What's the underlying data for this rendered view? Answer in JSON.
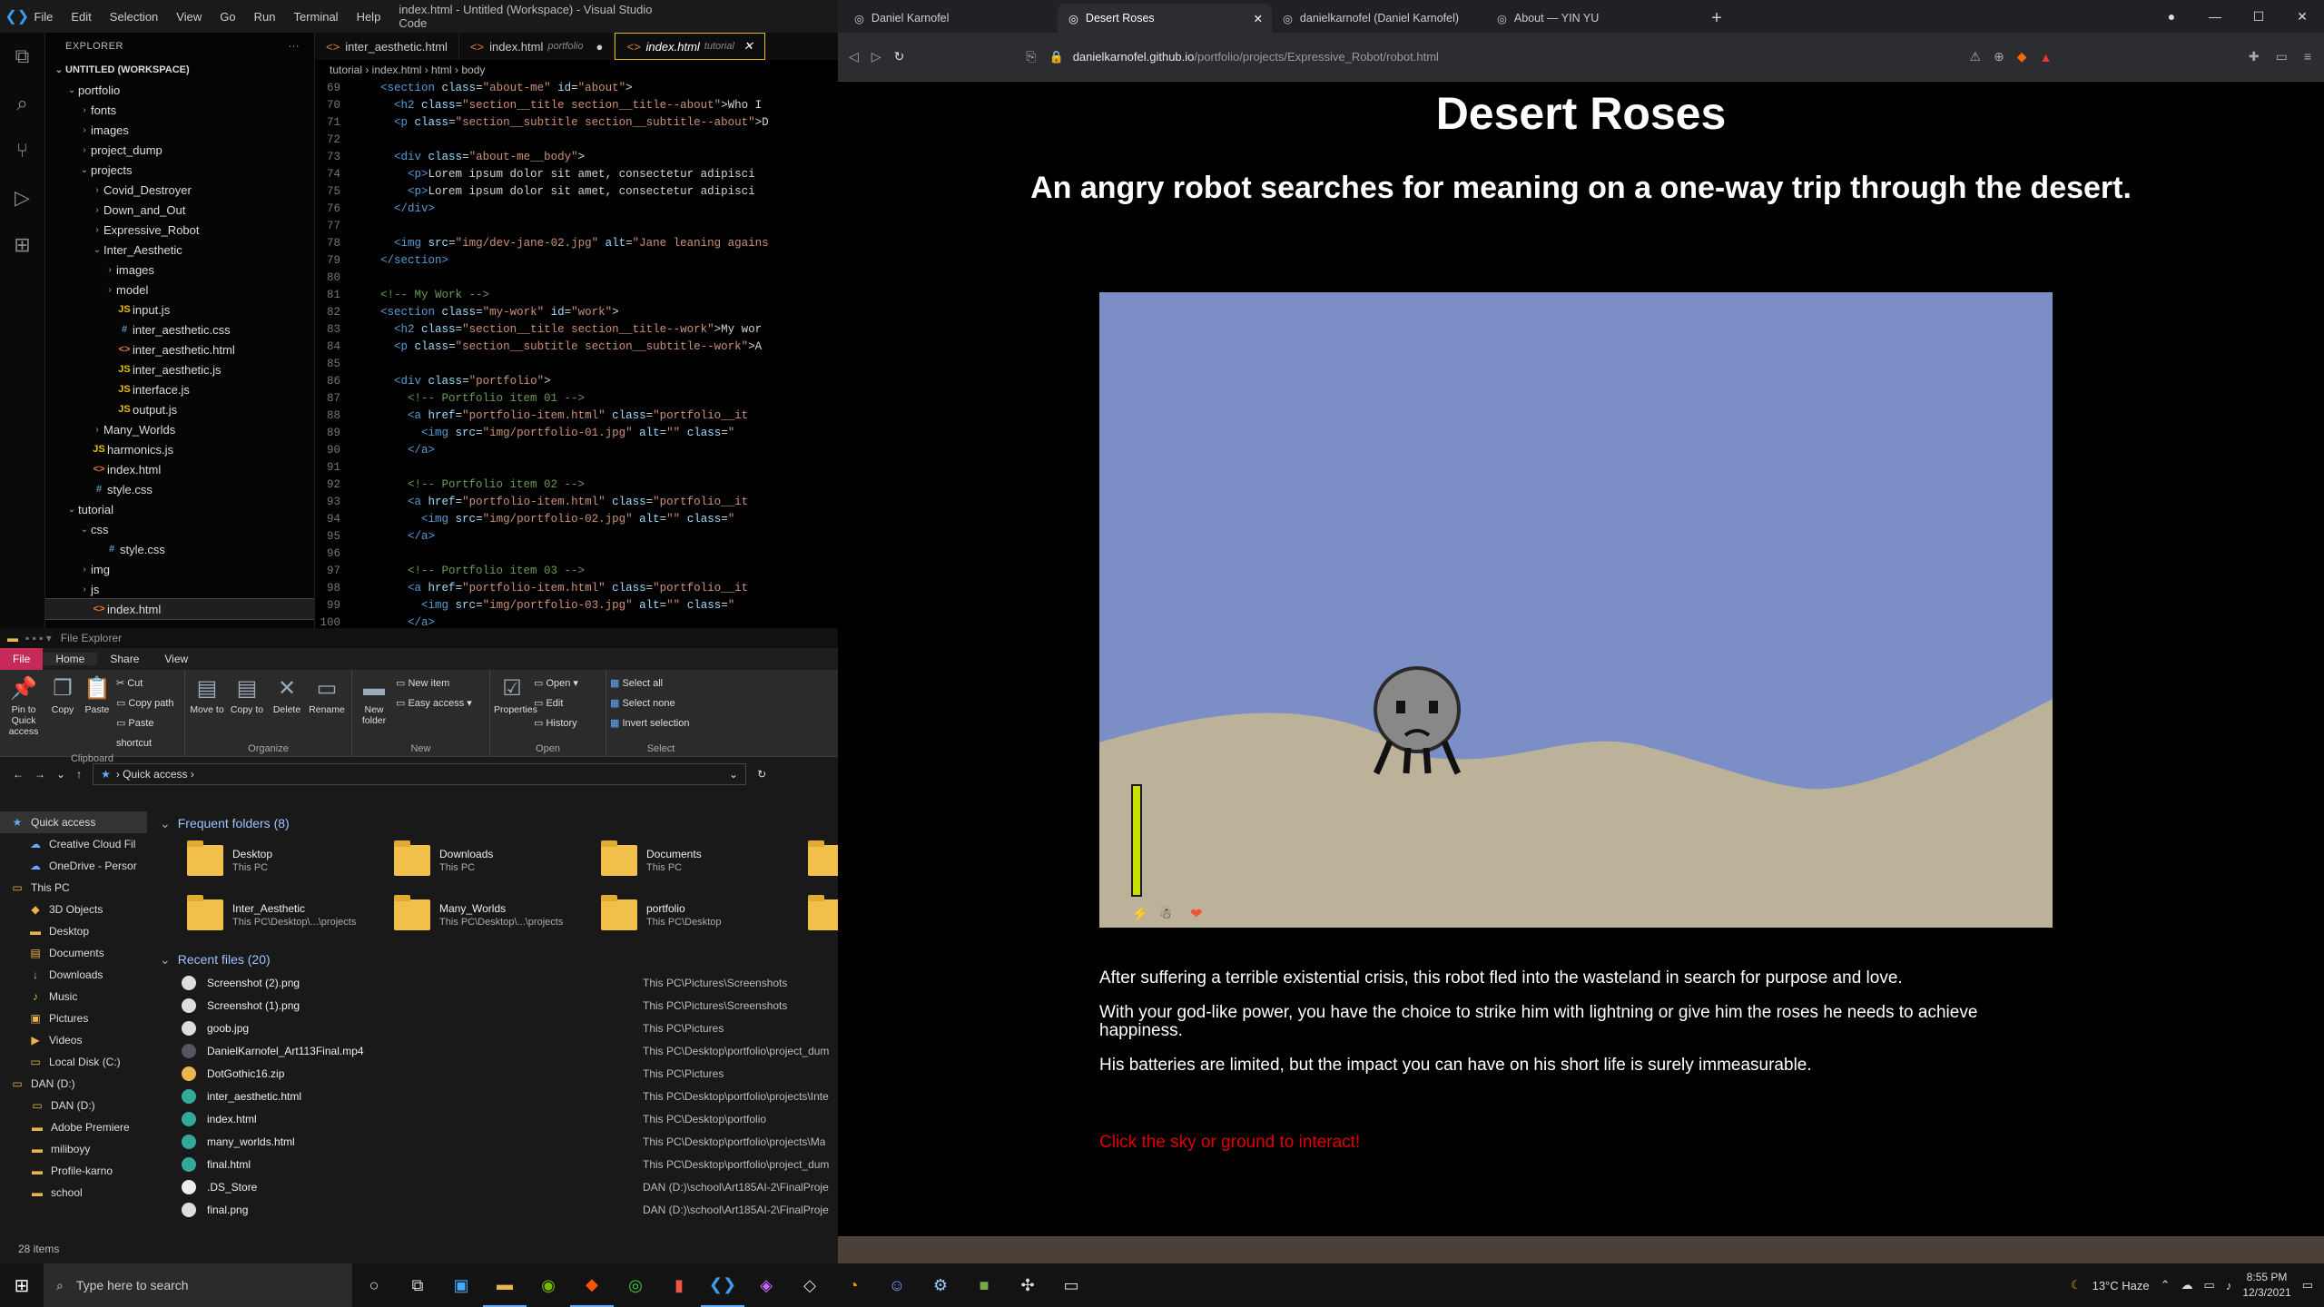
{
  "vscode": {
    "menu": [
      "File",
      "Edit",
      "Selection",
      "View",
      "Go",
      "Run",
      "Terminal",
      "Help"
    ],
    "title": "index.html - Untitled (Workspace) - Visual Studio Code",
    "explorer_label": "EXPLORER",
    "workspace": "UNTITLED (WORKSPACE)",
    "tree": [
      {
        "label": "portfolio",
        "d": 1,
        "t": "open"
      },
      {
        "label": "fonts",
        "d": 2,
        "t": "closed"
      },
      {
        "label": "images",
        "d": 2,
        "t": "closed"
      },
      {
        "label": "project_dump",
        "d": 2,
        "t": "closed"
      },
      {
        "label": "projects",
        "d": 2,
        "t": "open"
      },
      {
        "label": "Covid_Destroyer",
        "d": 3,
        "t": "closed"
      },
      {
        "label": "Down_and_Out",
        "d": 3,
        "t": "closed"
      },
      {
        "label": "Expressive_Robot",
        "d": 3,
        "t": "closed"
      },
      {
        "label": "Inter_Aesthetic",
        "d": 3,
        "t": "open"
      },
      {
        "label": "images",
        "d": 4,
        "t": "closed"
      },
      {
        "label": "model",
        "d": 4,
        "t": "closed"
      },
      {
        "label": "input.js",
        "d": 4,
        "t": "js"
      },
      {
        "label": "inter_aesthetic.css",
        "d": 4,
        "t": "css"
      },
      {
        "label": "inter_aesthetic.html",
        "d": 4,
        "t": "html"
      },
      {
        "label": "inter_aesthetic.js",
        "d": 4,
        "t": "js"
      },
      {
        "label": "interface.js",
        "d": 4,
        "t": "js"
      },
      {
        "label": "output.js",
        "d": 4,
        "t": "js"
      },
      {
        "label": "Many_Worlds",
        "d": 3,
        "t": "closed"
      },
      {
        "label": "harmonics.js",
        "d": 2,
        "t": "js"
      },
      {
        "label": "index.html",
        "d": 2,
        "t": "html"
      },
      {
        "label": "style.css",
        "d": 2,
        "t": "css"
      },
      {
        "label": "tutorial",
        "d": 1,
        "t": "open"
      },
      {
        "label": "css",
        "d": 2,
        "t": "open"
      },
      {
        "label": "style.css",
        "d": 3,
        "t": "css"
      },
      {
        "label": "img",
        "d": 2,
        "t": "closed"
      },
      {
        "label": "js",
        "d": 2,
        "t": "closed"
      },
      {
        "label": "index.html",
        "d": 2,
        "t": "html",
        "sel": true
      }
    ],
    "tabs": [
      {
        "label": "inter_aesthetic.html",
        "sub": ""
      },
      {
        "label": "index.html",
        "sub": "portfolio",
        "dot": "●"
      },
      {
        "label": "index.html",
        "sub": "tutorial",
        "x": "✕",
        "active": true
      }
    ],
    "breadcrumb": "tutorial  ›  index.html  ›  html  ›  body",
    "code_lines": [
      {
        "n": "69",
        "h": "    <span class='tg'>&lt;section</span> <span class='at'>class</span>=<span class='st'>\"about-me\"</span> <span class='at'>id</span>=<span class='st'>\"about\"</span>&gt;"
      },
      {
        "n": "70",
        "h": "      <span class='tg'>&lt;h2</span> <span class='at'>class</span>=<span class='st'>\"section__title section__title--about\"</span>&gt;Who I"
      },
      {
        "n": "71",
        "h": "      <span class='tg'>&lt;p</span> <span class='at'>class</span>=<span class='st'>\"section__subtitle section__subtitle--about\"</span>&gt;D"
      },
      {
        "n": "72",
        "h": ""
      },
      {
        "n": "73",
        "h": "      <span class='tg'>&lt;div</span> <span class='at'>class</span>=<span class='st'>\"about-me__body\"</span>&gt;"
      },
      {
        "n": "74",
        "h": "        <span class='tg'>&lt;p&gt;</span>Lorem ipsum dolor sit amet, consectetur adipisci"
      },
      {
        "n": "75",
        "h": "        <span class='tg'>&lt;p&gt;</span>Lorem ipsum dolor sit amet, consectetur adipisci"
      },
      {
        "n": "76",
        "h": "      <span class='tg'>&lt;/div&gt;</span>"
      },
      {
        "n": "77",
        "h": ""
      },
      {
        "n": "78",
        "h": "      <span class='tg'>&lt;img</span> <span class='at'>src</span>=<span class='st'>\"img/dev-jane-02.jpg\"</span> <span class='at'>alt</span>=<span class='st'>\"Jane leaning agains</span>"
      },
      {
        "n": "79",
        "h": "    <span class='tg'>&lt;/section&gt;</span>"
      },
      {
        "n": "80",
        "h": ""
      },
      {
        "n": "81",
        "h": "    <span class='cm'>&lt;!-- My Work --&gt;</span>"
      },
      {
        "n": "82",
        "h": "    <span class='tg'>&lt;section</span> <span class='at'>class</span>=<span class='st'>\"my-work\"</span> <span class='at'>id</span>=<span class='st'>\"work\"</span>&gt;"
      },
      {
        "n": "83",
        "h": "      <span class='tg'>&lt;h2</span> <span class='at'>class</span>=<span class='st'>\"section__title section__title--work\"</span>&gt;My wor"
      },
      {
        "n": "84",
        "h": "      <span class='tg'>&lt;p</span> <span class='at'>class</span>=<span class='st'>\"section__subtitle section__subtitle--work\"</span>&gt;A"
      },
      {
        "n": "85",
        "h": ""
      },
      {
        "n": "86",
        "h": "      <span class='tg'>&lt;div</span> <span class='at'>class</span>=<span class='st'>\"portfolio\"</span>&gt;"
      },
      {
        "n": "87",
        "h": "        <span class='cm'>&lt;!-- Portfolio item 01 --&gt;</span>"
      },
      {
        "n": "88",
        "h": "        <span class='tg'>&lt;a</span> <span class='at'>href</span>=<span class='st'>\"portfolio-item.html\"</span> <span class='at'>class</span>=<span class='st'>\"portfolio__it</span>"
      },
      {
        "n": "89",
        "h": "          <span class='tg'>&lt;img</span> <span class='at'>src</span>=<span class='st'>\"img/portfolio-01.jpg\"</span> <span class='at'>alt</span>=<span class='st'>\"\"</span> <span class='at'>class</span>=<span class='st'>\"</span>"
      },
      {
        "n": "90",
        "h": "        <span class='tg'>&lt;/a&gt;</span>"
      },
      {
        "n": "91",
        "h": ""
      },
      {
        "n": "92",
        "h": "        <span class='cm'>&lt;!-- Portfolio item 02 --&gt;</span>"
      },
      {
        "n": "93",
        "h": "        <span class='tg'>&lt;a</span> <span class='at'>href</span>=<span class='st'>\"portfolio-item.html\"</span> <span class='at'>class</span>=<span class='st'>\"portfolio__it</span>"
      },
      {
        "n": "94",
        "h": "          <span class='tg'>&lt;img</span> <span class='at'>src</span>=<span class='st'>\"img/portfolio-02.jpg\"</span> <span class='at'>alt</span>=<span class='st'>\"\"</span> <span class='at'>class</span>=<span class='st'>\"</span>"
      },
      {
        "n": "95",
        "h": "        <span class='tg'>&lt;/a&gt;</span>"
      },
      {
        "n": "96",
        "h": ""
      },
      {
        "n": "97",
        "h": "        <span class='cm'>&lt;!-- Portfolio item 03 --&gt;</span>"
      },
      {
        "n": "98",
        "h": "        <span class='tg'>&lt;a</span> <span class='at'>href</span>=<span class='st'>\"portfolio-item.html\"</span> <span class='at'>class</span>=<span class='st'>\"portfolio__it</span>"
      },
      {
        "n": "99",
        "h": "          <span class='tg'>&lt;img</span> <span class='at'>src</span>=<span class='st'>\"img/portfolio-03.jpg\"</span> <span class='at'>alt</span>=<span class='st'>\"\"</span> <span class='at'>class</span>=<span class='st'>\"</span>"
      },
      {
        "n": "100",
        "h": "        <span class='tg'>&lt;/a&gt;</span>"
      }
    ]
  },
  "explorer": {
    "title": "File Explorer",
    "ribbon_tabs": [
      "File",
      "Home",
      "Share",
      "View"
    ],
    "ribbon": {
      "clipboard": {
        "pin": "Pin to Quick access",
        "copy": "Copy",
        "paste": "Paste",
        "cut": "Cut",
        "copy_path": "Copy path",
        "paste_shortcut": "Paste shortcut",
        "label": "Clipboard"
      },
      "organize": {
        "move": "Move to",
        "copy": "Copy to",
        "delete": "Delete",
        "rename": "Rename",
        "label": "Organize"
      },
      "new": {
        "folder": "New folder",
        "item": "New item",
        "easy": "Easy access",
        "label": "New"
      },
      "open": {
        "props": "Properties",
        "open": "Open",
        "edit": "Edit",
        "history": "History",
        "label": "Open"
      },
      "select": {
        "all": "Select all",
        "none": "Select none",
        "invert": "Invert selection",
        "label": "Select"
      }
    },
    "address": "Quick access",
    "nav": [
      {
        "label": "Quick access",
        "icon": "★",
        "sel": true
      },
      {
        "label": "Creative Cloud Fil",
        "icon": "☁"
      },
      {
        "label": "OneDrive - Persor",
        "icon": "☁"
      },
      {
        "label": "This PC",
        "icon": "▭"
      },
      {
        "label": "3D Objects",
        "icon": "◆"
      },
      {
        "label": "Desktop",
        "icon": "▬"
      },
      {
        "label": "Documents",
        "icon": "▤"
      },
      {
        "label": "Downloads",
        "icon": "↓"
      },
      {
        "label": "Music",
        "icon": "♪"
      },
      {
        "label": "Pictures",
        "icon": "▣"
      },
      {
        "label": "Videos",
        "icon": "▶"
      },
      {
        "label": "Local Disk (C:)",
        "icon": "▭"
      },
      {
        "label": "DAN (D:)",
        "icon": "▭"
      },
      {
        "label": "DAN (D:)",
        "icon": "▭"
      },
      {
        "label": "Adobe Premiere",
        "icon": "▬"
      },
      {
        "label": "miliboyy",
        "icon": "▬"
      },
      {
        "label": "Profile-karno",
        "icon": "▬"
      },
      {
        "label": "school",
        "icon": "▬"
      }
    ],
    "frequent_header": "Frequent folders (8)",
    "frequent": [
      {
        "name": "Desktop",
        "sub": "This PC"
      },
      {
        "name": "Downloads",
        "sub": "This PC"
      },
      {
        "name": "Documents",
        "sub": "This PC"
      },
      {
        "name": "",
        "sub": ""
      },
      {
        "name": "Inter_Aesthetic",
        "sub": "This PC\\Desktop\\...\\projects"
      },
      {
        "name": "Many_Worlds",
        "sub": "This PC\\Desktop\\...\\projects"
      },
      {
        "name": "portfolio",
        "sub": "This PC\\Desktop"
      },
      {
        "name": "",
        "sub": ""
      }
    ],
    "recent_header": "Recent files (20)",
    "recent": [
      {
        "name": "Screenshot (2).png",
        "path": "This PC\\Pictures\\Screenshots",
        "c": "#ddd"
      },
      {
        "name": "Screenshot (1).png",
        "path": "This PC\\Pictures\\Screenshots",
        "c": "#ddd"
      },
      {
        "name": "goob.jpg",
        "path": "This PC\\Pictures",
        "c": "#ddd"
      },
      {
        "name": "DanielKarnofel_Art113Final.mp4",
        "path": "This PC\\Desktop\\portfolio\\project_dum",
        "c": "#556"
      },
      {
        "name": "DotGothic16.zip",
        "path": "This PC\\Pictures",
        "c": "#e8b64a"
      },
      {
        "name": "inter_aesthetic.html",
        "path": "This PC\\Desktop\\portfolio\\projects\\Inte",
        "c": "#3a9"
      },
      {
        "name": "index.html",
        "path": "This PC\\Desktop\\portfolio",
        "c": "#3a9"
      },
      {
        "name": "many_worlds.html",
        "path": "This PC\\Desktop\\portfolio\\projects\\Ma",
        "c": "#3a9"
      },
      {
        "name": "final.html",
        "path": "This PC\\Desktop\\portfolio\\project_dum",
        "c": "#3a9"
      },
      {
        "name": ".DS_Store",
        "path": "DAN (D:)\\school\\Art185AI-2\\FinalProje",
        "c": "#eee"
      },
      {
        "name": "final.png",
        "path": "DAN (D:)\\school\\Art185AI-2\\FinalProje",
        "c": "#ddd"
      }
    ],
    "status": "28 items"
  },
  "browser": {
    "tabs": [
      {
        "label": "Daniel Karnofel"
      },
      {
        "label": "Desert Roses",
        "active": true,
        "x": "✕"
      },
      {
        "label": "danielkarnofel (Daniel Karnofel)"
      },
      {
        "label": "About — YIN YU"
      }
    ],
    "new_tab": "+",
    "url_host": "danielkarnofel.github.io",
    "url_path": "/portfolio/projects/Expressive_Robot/robot.html",
    "page": {
      "title": "Desert Roses",
      "subtitle": "An angry robot searches for meaning on a one-way trip through the desert.",
      "p1": "After suffering a terrible existential crisis, this robot fled into the wasteland in search for purpose and love.",
      "p2": "With your god-like power, you have the choice to strike him with lightning or give him the roses he needs to achieve happiness.",
      "p3": "His batteries are limited, but the impact you can have on his short life is surely immeasurable.",
      "cta": "Click the sky or ground to interact!",
      "battery_level": 1.0,
      "colors": {
        "sky": "#7b8ec5",
        "sand": "#bcb199",
        "cta": "#e00000"
      }
    }
  },
  "taskbar": {
    "search_placeholder": "Type here to search",
    "weather": "13°C  Haze",
    "time": "8:55 PM",
    "date": "12/3/2021"
  }
}
